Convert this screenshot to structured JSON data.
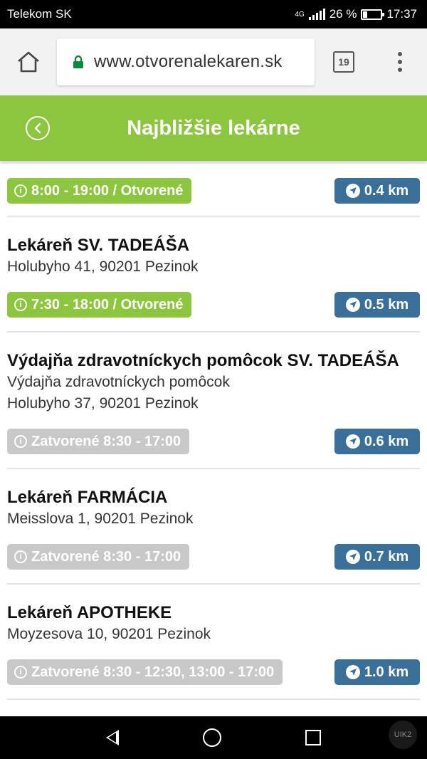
{
  "statusbar": {
    "carrier": "Telekom SK",
    "network": "4G",
    "battery": "26 %",
    "battery_level": 0.26,
    "time": "17:37"
  },
  "browser": {
    "url": "www.otvorenalekaren.sk",
    "tab_count": "19"
  },
  "header": {
    "title": "Najbližšie lekárne"
  },
  "pharmacies": [
    {
      "name": "",
      "subtitle": "",
      "address": "",
      "hours": "8:00 - 19:00 / Otvorené",
      "status": "open",
      "distance": "0.4 km"
    },
    {
      "name": "Lekáreň SV. TADEÁŠA",
      "subtitle": "",
      "address": "Holubyho 41, 90201 Pezinok",
      "hours": "7:30 - 18:00 / Otvorené",
      "status": "open",
      "distance": "0.5 km"
    },
    {
      "name": "Výdajňa zdravotníckych pomôcok SV. TADEÁŠA",
      "subtitle": "Výdajňa zdravotníckych pomôcok",
      "address": "Holubyho 37, 90201 Pezinok",
      "hours": "Zatvorené 8:30 - 17:00",
      "status": "closed",
      "distance": "0.6 km"
    },
    {
      "name": "Lekáreň FARMÁCIA",
      "subtitle": "",
      "address": "Meisslova 1, 90201 Pezinok",
      "hours": "Zatvorené 8:30 - 17:00",
      "status": "closed",
      "distance": "0.7 km"
    },
    {
      "name": "Lekáreň APOTHEKE",
      "subtitle": "",
      "address": "Moyzesova 10, 90201 Pezinok",
      "hours": "Zatvorené 8:30 - 12:30, 13:00 - 17:00",
      "status": "closed",
      "distance": "1.0 km"
    }
  ],
  "icons": {
    "home": "home-icon",
    "lock": "lock-icon",
    "tabs": "tabs-icon",
    "menu": "overflow-menu-icon",
    "back": "back-circle-icon",
    "info": "info-icon",
    "navigate": "navigation-arrow-icon"
  },
  "colors": {
    "accent_green": "#8cc63f",
    "distance_blue": "#3a6f99",
    "closed_gray": "#c8c8c8"
  },
  "watermark": "UIK2"
}
